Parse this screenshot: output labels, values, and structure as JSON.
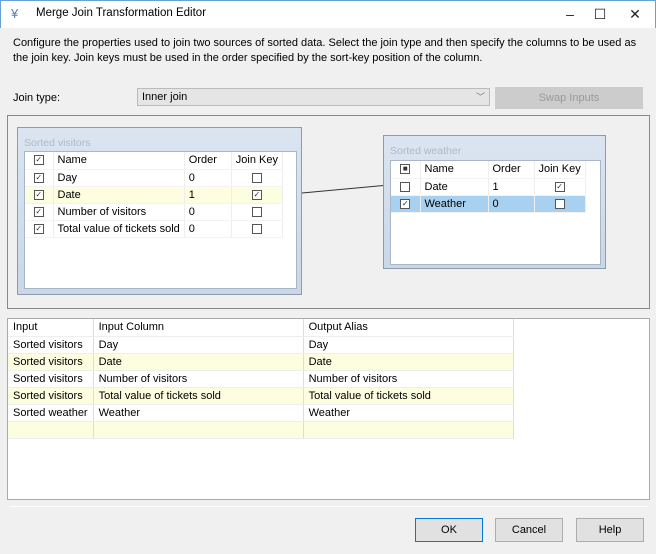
{
  "window": {
    "title": "Merge Join Transformation Editor"
  },
  "description": "Configure the properties used to join two sources of sorted data. Select the join type and then specify the columns to be used as the join key. Join keys must be used in the order specified by the sort-key position of the column.",
  "join_type": {
    "label": "Join type:",
    "value": "Inner join"
  },
  "swap_inputs_label": "Swap Inputs",
  "columns_header": {
    "name": "Name",
    "order": "Order",
    "join_key": "Join Key"
  },
  "left_input": {
    "title": "Sorted visitors",
    "rows": [
      {
        "checked": true,
        "name": "Day",
        "order": "0",
        "join_key": false
      },
      {
        "checked": true,
        "name": "Date",
        "order": "1",
        "join_key": true
      },
      {
        "checked": true,
        "name": "Number of visitors",
        "order": "0",
        "join_key": false
      },
      {
        "checked": true,
        "name": "Total value of tickets sold",
        "order": "0",
        "join_key": false
      }
    ]
  },
  "right_input": {
    "title": "Sorted weather",
    "rows": [
      {
        "checked": false,
        "name": "Date",
        "order": "1",
        "join_key": true
      },
      {
        "checked": true,
        "name": "Weather",
        "order": "0",
        "join_key": false
      }
    ]
  },
  "output_grid": {
    "headers": [
      "Input",
      "Input Column",
      "Output Alias"
    ],
    "rows": [
      [
        "Sorted visitors",
        "Day",
        "Day"
      ],
      [
        "Sorted visitors",
        "Date",
        "Date"
      ],
      [
        "Sorted visitors",
        "Number of visitors",
        "Number of visitors"
      ],
      [
        "Sorted visitors",
        "Total value of tickets sold",
        "Total value of tickets sold"
      ],
      [
        "Sorted weather",
        "Weather",
        "Weather"
      ]
    ]
  },
  "buttons": {
    "ok": "OK",
    "cancel": "Cancel",
    "help": "Help"
  }
}
